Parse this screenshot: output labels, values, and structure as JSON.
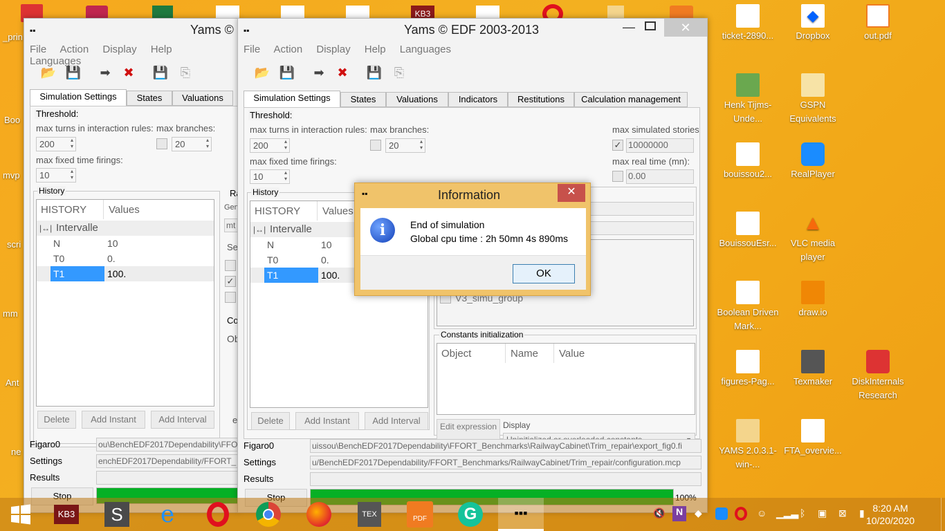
{
  "desktop": {
    "left_cut_labels": [
      "_prin",
      "Boo",
      "mvp",
      "scri",
      "mm",
      "Ant",
      "ne"
    ],
    "icons": [
      {
        "label": "ticket-2890...",
        "icon": "document-icon"
      },
      {
        "label": "Dropbox",
        "icon": "dropbox-icon"
      },
      {
        "label": "out.pdf",
        "icon": "pdf-icon"
      },
      {
        "label": "Henk Tijms-Unde...",
        "icon": "book-icon"
      },
      {
        "label": "GSPN Equivalents",
        "icon": "folder-icon"
      },
      {
        "label": "bouissou2...",
        "icon": "document-icon"
      },
      {
        "label": "RealPlayer",
        "icon": "realplayer-icon"
      },
      {
        "label": "BouissouEsr...",
        "icon": "document-icon"
      },
      {
        "label": "VLC media player",
        "icon": "vlc-icon"
      },
      {
        "label": "Boolean Driven Mark...",
        "icon": "document-icon"
      },
      {
        "label": "draw.io",
        "icon": "drawio-icon"
      },
      {
        "label": "figures-Pag...",
        "icon": "document-icon"
      },
      {
        "label": "Texmaker",
        "icon": "texmaker-icon"
      },
      {
        "label": "DiskInternals Research",
        "icon": "diskinternals-icon"
      },
      {
        "label": "YAMS 2.0.3.1-win-...",
        "icon": "folder-icon"
      },
      {
        "label": "FTA_overvie...",
        "icon": "document-icon"
      }
    ]
  },
  "back_window": {
    "title": "Yams ©",
    "menu": [
      "File",
      "Action",
      "Display",
      "Help",
      "Languages"
    ],
    "tabs": [
      "Simulation Settings",
      "States",
      "Valuations"
    ],
    "threshold_label": "Threshold:",
    "max_turns_label": "max turns in interaction rules:",
    "max_turns_value": "200",
    "max_branches_label": "max branches:",
    "max_branches_value": "20",
    "max_fixed_label": "max fixed time firings:",
    "max_fixed_value": "10",
    "history_label": "History",
    "history_col": "HISTORY",
    "values_col": "Values",
    "intervalle": "Intervalle",
    "rows": [
      {
        "k": "N",
        "v": "10"
      },
      {
        "k": "T0",
        "v": "0."
      },
      {
        "k": "T1",
        "v": "100."
      }
    ],
    "side_labels": {
      "ra": "Ra",
      "gen": "Gen",
      "mt": "mt",
      "se": "Se",
      "co": "Co",
      "ob": "Ob",
      "e": "e"
    },
    "delete": "Delete",
    "add_instant": "Add Instant",
    "add_interval": "Add Interval",
    "figaro": "Figaro0",
    "settings": "Settings",
    "results": "Results",
    "figaro_path": "ou\\BenchEDF2017Dependability\\FFO",
    "settings_path": "enchEDF2017Dependability/FFORT_",
    "stop": "Stop"
  },
  "main_window": {
    "title": "Yams © EDF 2003-2013",
    "menu": [
      "File",
      "Action",
      "Display",
      "Help",
      "Languages"
    ],
    "tabs": [
      "Simulation Settings",
      "States",
      "Valuations",
      "Indicators",
      "Restitutions",
      "Calculation management"
    ],
    "threshold_label": "Threshold:",
    "max_turns_label": "max turns in interaction rules:",
    "max_turns_value": "200",
    "max_branches_label": "max branches:",
    "max_branches_value": "20",
    "max_sim_label": "max simulated stories",
    "max_sim_value": "10000000",
    "max_fixed_label": "max fixed time firings:",
    "max_fixed_value": "10",
    "max_real_label": "max real time (mn):",
    "max_real_value": "0.00",
    "history_label": "History",
    "history_col": "HISTORY",
    "values_col": "Values",
    "intervalle": "Intervalle",
    "rows": [
      {
        "k": "N",
        "v": "10"
      },
      {
        "k": "T0",
        "v": "0."
      },
      {
        "k": "T1",
        "v": "100."
      }
    ],
    "group_item": "V3_simu_group",
    "constants_label": "Constants initialization",
    "const_cols": [
      "Object",
      "Name",
      "Value"
    ],
    "edit_expression": "Edit expression",
    "display_label": "Display",
    "display_value": "Uninitialized or overloaded constants",
    "delete": "Delete",
    "add_instant": "Add Instant",
    "add_interval": "Add Interval",
    "figaro": "Figaro0",
    "settings": "Settings",
    "results": "Results",
    "figaro_path": "uissou\\BenchEDF2017Dependability\\FFORT_Benchmarks\\RailwayCabinet\\Trim_repair\\export_fig0.fi",
    "settings_path": "u/BenchEDF2017Dependability/FFORT_Benchmarks/RailwayCabinet/Trim_repair/configuration.mcp",
    "stop": "Stop",
    "progress_text": "100%",
    "progress": 1.0
  },
  "dialog": {
    "title": "Information",
    "line1": "End of simulation",
    "line2": "Global cpu time : 2h 50mn 4s 890ms",
    "ok": "OK"
  },
  "taskbar": {
    "time": "8:20 AM",
    "date": "10/20/2020",
    "apps": [
      "kb3-icon",
      "sublime-icon",
      "ie-icon",
      "opera-icon",
      "chrome-icon",
      "firefox-icon",
      "texmaker-icon",
      "pdf-icon",
      "grammarly-icon",
      "yams-icon"
    ]
  },
  "colors": {
    "accent": "#3399ff",
    "progress": "#06b025",
    "dialog_frame": "#f0c36a",
    "close_red": "#c7514b"
  }
}
